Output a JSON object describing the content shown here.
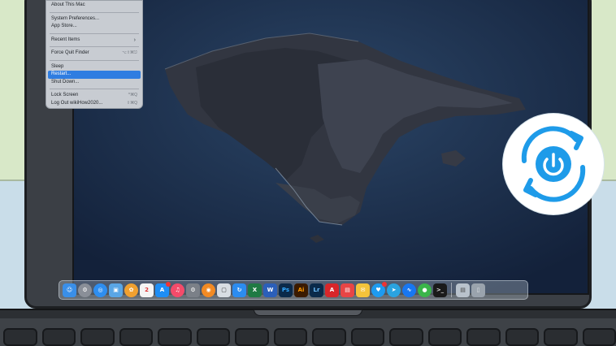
{
  "apple_menu": {
    "items": [
      {
        "label": "About This Mac"
      },
      {
        "sep": true
      },
      {
        "label": "System Preferences..."
      },
      {
        "label": "App Store..."
      },
      {
        "sep": true
      },
      {
        "label": "Recent Items",
        "submenu": true
      },
      {
        "sep": true
      },
      {
        "label": "Force Quit Finder",
        "shortcut": "⌥⇧⌘⎋"
      },
      {
        "sep": true
      },
      {
        "label": "Sleep"
      },
      {
        "label": "Restart...",
        "selected": true
      },
      {
        "label": "Shut Down..."
      },
      {
        "sep": true
      },
      {
        "label": "Lock Screen",
        "shortcut": "^⌘Q"
      },
      {
        "label": "Log Out wikiHow2020...",
        "shortcut": "⇧⌘Q"
      }
    ]
  },
  "dock": {
    "apps": [
      {
        "name": "finder-icon",
        "color": "#3a8fe8",
        "glyph": "☺"
      },
      {
        "name": "launchpad-icon",
        "color": "#8a8f98",
        "glyph": "⚙",
        "round": true
      },
      {
        "name": "safari-icon",
        "color": "#2e8ef0",
        "glyph": "◎",
        "round": true
      },
      {
        "name": "photo-icon",
        "color": "#5aa6e6",
        "glyph": "▣"
      },
      {
        "name": "photos-icon",
        "color": "#f0a030",
        "glyph": "✿",
        "round": true
      },
      {
        "name": "calendar-icon",
        "color": "#f4f4f4",
        "glyph": "2",
        "text_color": "#d33"
      },
      {
        "name": "app-store-icon",
        "color": "#1e8ef5",
        "glyph": "A",
        "badge": true
      },
      {
        "name": "music-icon",
        "color": "#f44b6a",
        "glyph": "♫",
        "round": true
      },
      {
        "name": "system-preferences-icon",
        "color": "#7b8088",
        "glyph": "⚙"
      },
      {
        "name": "firefox-icon",
        "color": "#f28a23",
        "glyph": "◉",
        "round": true
      },
      {
        "name": "screenshot-icon",
        "color": "#d8dde3",
        "glyph": "▢",
        "text_color": "#333"
      },
      {
        "name": "sync-icon",
        "color": "#2c8cf0",
        "glyph": "↻"
      },
      {
        "name": "excel-icon",
        "color": "#1f7a44",
        "glyph": "X"
      },
      {
        "name": "word-icon",
        "color": "#2b5fb9",
        "glyph": "W"
      },
      {
        "name": "photoshop-icon",
        "color": "#0b2a4a",
        "glyph": "Ps",
        "text_color": "#31a8ff"
      },
      {
        "name": "illustrator-icon",
        "color": "#3a1a00",
        "glyph": "Ai",
        "text_color": "#ff9a00"
      },
      {
        "name": "lightroom-icon",
        "color": "#0b2a4a",
        "glyph": "Lr",
        "text_color": "#6ec0ff"
      },
      {
        "name": "acrobat-icon",
        "color": "#d8262a",
        "glyph": "A"
      },
      {
        "name": "pdf-tool-icon",
        "color": "#e84545",
        "glyph": "▤"
      },
      {
        "name": "notes-icon",
        "color": "#f3c33b",
        "glyph": "✉"
      },
      {
        "name": "twitter-icon",
        "color": "#1d9bf0",
        "glyph": "♥",
        "badge": true,
        "round": true
      },
      {
        "name": "telegram-icon",
        "color": "#2aa3e0",
        "glyph": "➤",
        "round": true
      },
      {
        "name": "messenger-icon",
        "color": "#1877f2",
        "glyph": "∿",
        "round": true
      },
      {
        "name": "wifi-tool-icon",
        "color": "#3bb54a",
        "glyph": "●",
        "round": true
      },
      {
        "name": "terminal-icon",
        "color": "#1a1a1a",
        "glyph": ">_",
        "text_color": "#ddd"
      }
    ],
    "right_apps": [
      {
        "name": "downloads-icon",
        "color": "#b9c2cc",
        "glyph": "▤",
        "text_color": "#444"
      },
      {
        "name": "trash-icon",
        "color": "#9aa3ad",
        "glyph": "▯",
        "text_color": "#e0e4e8"
      }
    ]
  },
  "restart_badge": {
    "accent": "#1e9be9"
  }
}
